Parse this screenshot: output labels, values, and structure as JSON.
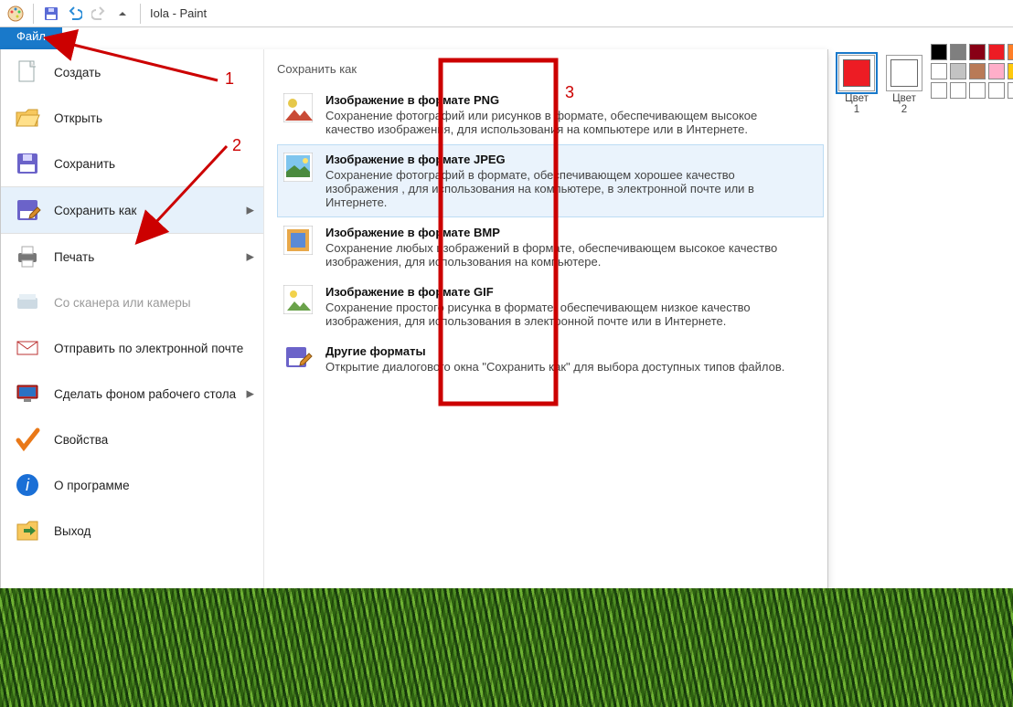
{
  "window": {
    "title": "Iola - Paint"
  },
  "file_tab": "Файл",
  "menu": {
    "items": [
      {
        "label": "Создать",
        "icon": "new",
        "arrow": false,
        "disabled": false
      },
      {
        "label": "Открыть",
        "icon": "open",
        "arrow": false,
        "disabled": false
      },
      {
        "label": "Сохранить",
        "icon": "save",
        "arrow": false,
        "disabled": false
      },
      {
        "label": "Сохранить как",
        "icon": "saveas",
        "arrow": true,
        "disabled": false,
        "selected": true
      },
      {
        "label": "Печать",
        "icon": "print",
        "arrow": true,
        "disabled": false
      },
      {
        "label": "Со сканера или камеры",
        "icon": "scanner",
        "arrow": false,
        "disabled": true
      },
      {
        "label": "Отправить по электронной почте",
        "icon": "mail",
        "arrow": false,
        "disabled": false
      },
      {
        "label": "Сделать фоном рабочего стола",
        "icon": "desktop",
        "arrow": true,
        "disabled": false
      },
      {
        "label": "Свойства",
        "icon": "check",
        "arrow": false,
        "disabled": false
      },
      {
        "label": "О программе",
        "icon": "info",
        "arrow": false,
        "disabled": false
      },
      {
        "label": "Выход",
        "icon": "exit",
        "arrow": false,
        "disabled": false
      }
    ]
  },
  "submenu": {
    "title": "Сохранить как",
    "items": [
      {
        "title": "Изображение в формате PNG",
        "desc": "Сохранение фотографий или рисунков в формате, обеспечивающем высокое качество изображения, для использования на компьютере или в Интернете.",
        "highlight": false,
        "icon": "png"
      },
      {
        "title": "Изображение в формате JPEG",
        "desc": "Сохранение фотографий в формате, обеспечивающем хорошее качество изображения , для использования на компьютере, в электронной почте или в Интернете.",
        "highlight": true,
        "icon": "jpeg"
      },
      {
        "title": "Изображение в формате BMP",
        "desc": "Сохранение любых изображений в формате, обеспечивающем высокое качество изображения, для использования на компьютере.",
        "highlight": false,
        "icon": "bmp"
      },
      {
        "title": "Изображение в формате GIF",
        "desc": "Сохранение простого рисунка в формате, обеспечивающем низкое качество изображения, для использования в электронной почте или в Интернете.",
        "highlight": false,
        "icon": "gif"
      },
      {
        "title": "Другие форматы",
        "desc": "Открытие диалогового окна \"Сохранить как\" для выбора доступных типов файлов.",
        "highlight": false,
        "icon": "other"
      }
    ]
  },
  "colors": {
    "well1_label": "Цвет\n1",
    "well2_label": "Цвет\n2",
    "well1_color": "#ed1c24",
    "well2_color": "#ffffff",
    "swatches": [
      "#000000",
      "#7f7f7f",
      "#880015",
      "#ed1c24",
      "#ff7f27",
      "#ffffff",
      "#c3c3c3",
      "#b97a57",
      "#ffaec9",
      "#ffc90e",
      "#ffffff",
      "#ffffff",
      "#ffffff",
      "#ffffff",
      "#ffffff"
    ]
  },
  "annotations": {
    "n1": "1",
    "n2": "2",
    "n3": "3"
  }
}
